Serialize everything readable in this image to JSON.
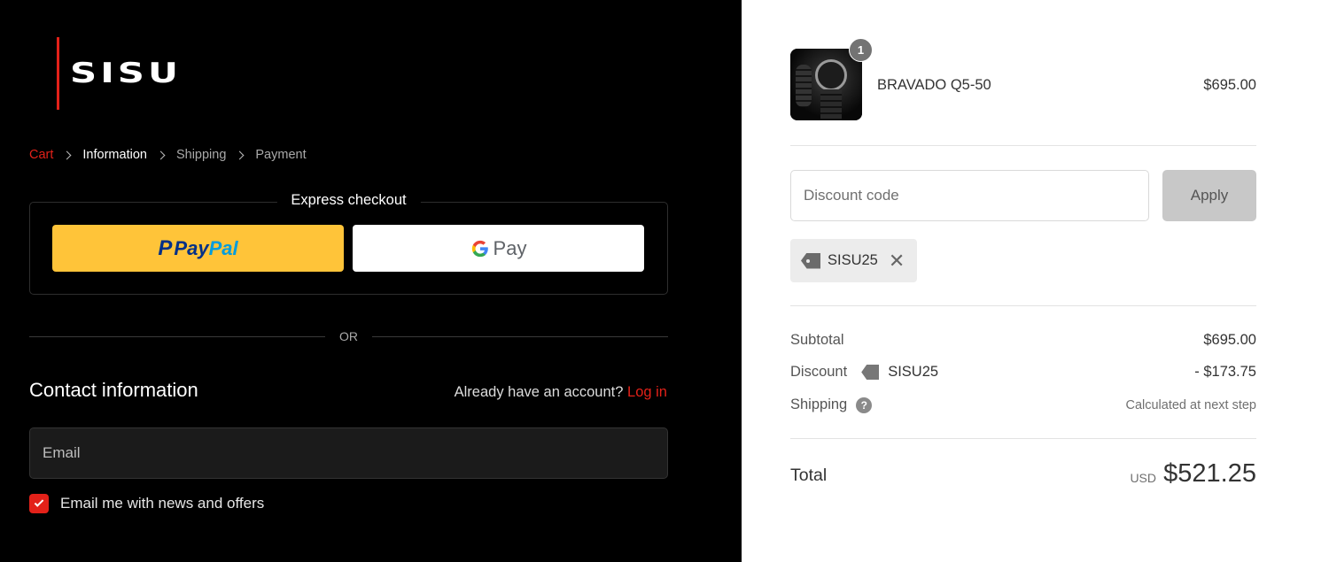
{
  "brand": {
    "logo_text": "SISU",
    "accent": "#e32119"
  },
  "breadcrumb": {
    "items": [
      {
        "label": "Cart",
        "state": "link"
      },
      {
        "label": "Information",
        "state": "current"
      },
      {
        "label": "Shipping",
        "state": "upcoming"
      },
      {
        "label": "Payment",
        "state": "upcoming"
      }
    ]
  },
  "express": {
    "title": "Express checkout",
    "paypal": {
      "mark": "P",
      "word_1": "Pay",
      "word_2": "Pal",
      "icon": "paypal-logo"
    },
    "gpay": {
      "g": "G",
      "word": "Pay",
      "icon": "google-pay-logo"
    }
  },
  "divider": {
    "or": "OR"
  },
  "contact": {
    "title": "Contact information",
    "account_prompt": "Already have an account?",
    "login_label": "Log in",
    "email_placeholder": "Email",
    "email_value": "",
    "newsletter_label": "Email me with news and offers",
    "newsletter_checked": true
  },
  "order": {
    "item": {
      "name": "BRAVADO Q5-50",
      "price": "$695.00",
      "quantity": "1",
      "image": "watch-thumbnail"
    },
    "discount": {
      "placeholder": "Discount code",
      "value": "",
      "apply_label": "Apply",
      "applied_code": "SISU25",
      "remove_icon": "close-icon"
    },
    "summary": {
      "subtotal_label": "Subtotal",
      "subtotal_value": "$695.00",
      "discount_label": "Discount",
      "discount_code": "SISU25",
      "discount_value": "- $173.75",
      "shipping_label": "Shipping",
      "shipping_help": "?",
      "shipping_value": "Calculated at next step",
      "total_label": "Total",
      "currency": "USD",
      "total_value": "$521.25"
    }
  }
}
